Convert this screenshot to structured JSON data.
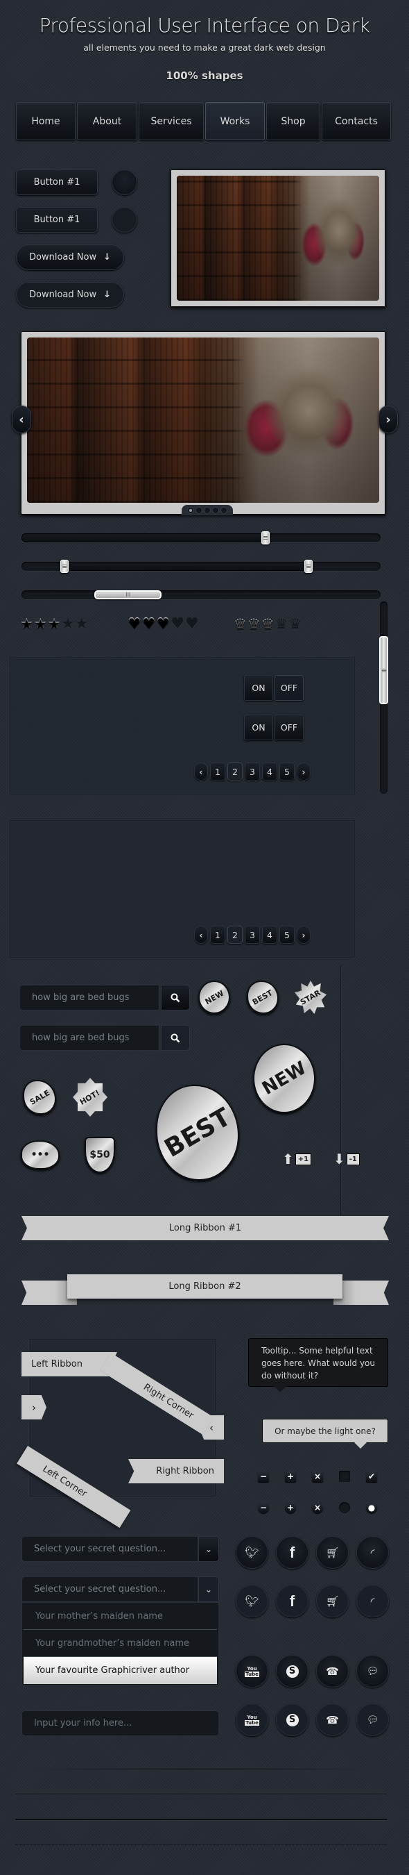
{
  "header": {
    "title": "Professional User Interface on Dark",
    "subtitle": "all elements you need to make a great dark web design",
    "tagline": "100% shapes"
  },
  "nav": {
    "items": [
      {
        "label": "Home",
        "active": false
      },
      {
        "label": "About",
        "active": false
      },
      {
        "label": "Services",
        "active": false
      },
      {
        "label": "Works",
        "active": true
      },
      {
        "label": "Shop",
        "active": false
      },
      {
        "label": "Contacts",
        "active": false
      }
    ]
  },
  "buttons": {
    "button1_label": "Button #1",
    "button2_label": "Button #1",
    "download1_label": "Download Now",
    "download2_label": "Download Now",
    "download_icon": "arrow-down-icon"
  },
  "slider": {
    "prev_icon": "chevron-left-icon",
    "next_icon": "chevron-right-icon",
    "total_slides": 5,
    "active_slide": 1
  },
  "range_sliders": {
    "single_value_percent": 68,
    "range_low_percent": 12,
    "range_high_percent": 80,
    "horizontal_scroll_position_percent": 25,
    "vertical_scroll_position_percent": 28
  },
  "ratings": [
    {
      "type": "star",
      "glyph": "★",
      "value": 3,
      "max": 5
    },
    {
      "type": "heart",
      "glyph": "♥",
      "value": 3,
      "max": 5
    },
    {
      "type": "crown",
      "glyph": "♛",
      "value": 3,
      "max": 5
    }
  ],
  "toggles": [
    {
      "on_label": "ON",
      "off_label": "OFF",
      "state": "off"
    },
    {
      "on_label": "ON",
      "off_label": "OFF",
      "state": "on"
    }
  ],
  "pagination": {
    "pages": [
      "1",
      "2",
      "3",
      "4",
      "5"
    ],
    "current": "2",
    "prev": "‹",
    "next": "›"
  },
  "search": {
    "value1": "how big are bed bugs",
    "value2": "how big are bed bugs",
    "icon": "search-icon"
  },
  "badges": {
    "new_small": "NEW",
    "best_small": "BEST",
    "star": "STAR",
    "new_large": "NEW",
    "sale": "SALE",
    "hot": "HOT!",
    "chat": "•••",
    "price": "$50",
    "best_large": "BEST",
    "vote_up": "+1",
    "vote_down": "-1"
  },
  "ribbons": {
    "long1": "Long Ribbon #1",
    "long2": "Long Ribbon #2",
    "left": "Left Ribbon",
    "right": "Right Ribbon",
    "right_corner": "Right Corner",
    "left_corner": "Left Corner",
    "tab_right_arrow": "›",
    "tab_left_arrow": "‹"
  },
  "tooltips": {
    "dark": "Tooltip... Some helpful text goes here. What would you do without it?",
    "light": "Or maybe the light one?"
  },
  "controls": {
    "square": [
      {
        "icon": "minus-icon",
        "glyph": "−"
      },
      {
        "icon": "plus-icon",
        "glyph": "+"
      },
      {
        "icon": "close-icon",
        "glyph": "×"
      },
      {
        "icon": "checkbox-unchecked",
        "glyph": ""
      },
      {
        "icon": "checkbox-checked",
        "glyph": "✔"
      }
    ],
    "round": [
      {
        "icon": "minus-icon",
        "glyph": "−"
      },
      {
        "icon": "plus-icon",
        "glyph": "+"
      },
      {
        "icon": "close-icon",
        "glyph": "×"
      },
      {
        "icon": "radio-unchecked",
        "glyph": ""
      },
      {
        "icon": "radio-checked",
        "glyph": "●"
      }
    ]
  },
  "selects": {
    "placeholder1": "Select your secret question...",
    "placeholder2": "Select your secret question...",
    "options": [
      "Your mother’s maiden name",
      "Your grandmother’s maiden name",
      "Your favourite Graphicriver author"
    ],
    "highlighted_option": 2
  },
  "text_input": {
    "placeholder": "Input your info here..."
  },
  "social": {
    "row1": [
      "twitter-icon",
      "facebook-icon",
      "cart-icon",
      "rss-icon"
    ],
    "row2": [
      "youtube-icon",
      "skype-icon",
      "phone-icon",
      "chat-icon"
    ],
    "labels": {
      "facebook": "f",
      "youtube_top": "You",
      "youtube_bottom": "Tube",
      "skype": "S"
    }
  }
}
